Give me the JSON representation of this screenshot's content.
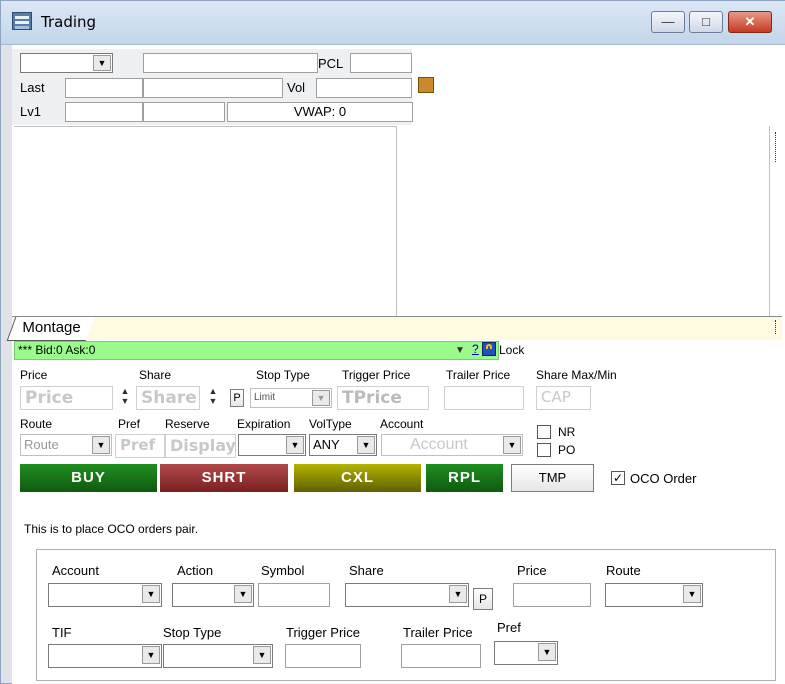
{
  "window": {
    "title": "Trading"
  },
  "top_panel": {
    "symbol_value": "",
    "pcl_label": "PCL",
    "last_label": "Last",
    "vol_label": "Vol",
    "lv1_label": "Lv1",
    "vwap_label": "VWAP: 0"
  },
  "tabs": {
    "montage": "Montage"
  },
  "quote_bar": {
    "text": "*** Bid:0 Ask:0",
    "help": "?",
    "lock_label": "Lock"
  },
  "order_entry": {
    "price_label": "Price",
    "share_label": "Share",
    "stop_type_label": "Stop Type",
    "trigger_price_label": "Trigger Price",
    "trailer_price_label": "Trailer Price",
    "share_maxmin_label": "Share Max/Min",
    "price_placeholder": "Price",
    "share_placeholder": "Share",
    "p_button": "P",
    "stop_type_value": "Limit",
    "tprice_placeholder": "TPrice",
    "cap_placeholder": "CAP",
    "route_label": "Route",
    "pref_label": "Pref",
    "reserve_label": "Reserve",
    "expiration_label": "Expiration",
    "voltype_label": "VolType",
    "account_label": "Account",
    "route_value": "Route",
    "pref_placeholder": "Pref",
    "display_placeholder": "Display",
    "voltype_value": "ANY",
    "account_placeholder": "Account",
    "nr_label": "NR",
    "po_label": "PO"
  },
  "actions": {
    "buy": "BUY",
    "shrt": "SHRT",
    "cxl": "CXL",
    "rpl": "RPL",
    "tmp": "TMP",
    "oco_label": "OCO Order",
    "oco_checked": true
  },
  "oco": {
    "description": "This is to place OCO orders pair.",
    "account_label": "Account",
    "action_label": "Action",
    "symbol_label": "Symbol",
    "share_label": "Share",
    "p_button": "P",
    "price_label": "Price",
    "route_label": "Route",
    "tif_label": "TIF",
    "stop_type_label": "Stop Type",
    "trigger_price_label": "Trigger Price",
    "trailer_price_label": "Trailer Price",
    "pref_label": "Pref"
  },
  "colors": {
    "buy": "#1a7a1a",
    "shrt": "#9a2e2e",
    "cxl": "#8a8a00",
    "rpl": "#1a7a1a",
    "quote_bar": "#9afa8b"
  }
}
